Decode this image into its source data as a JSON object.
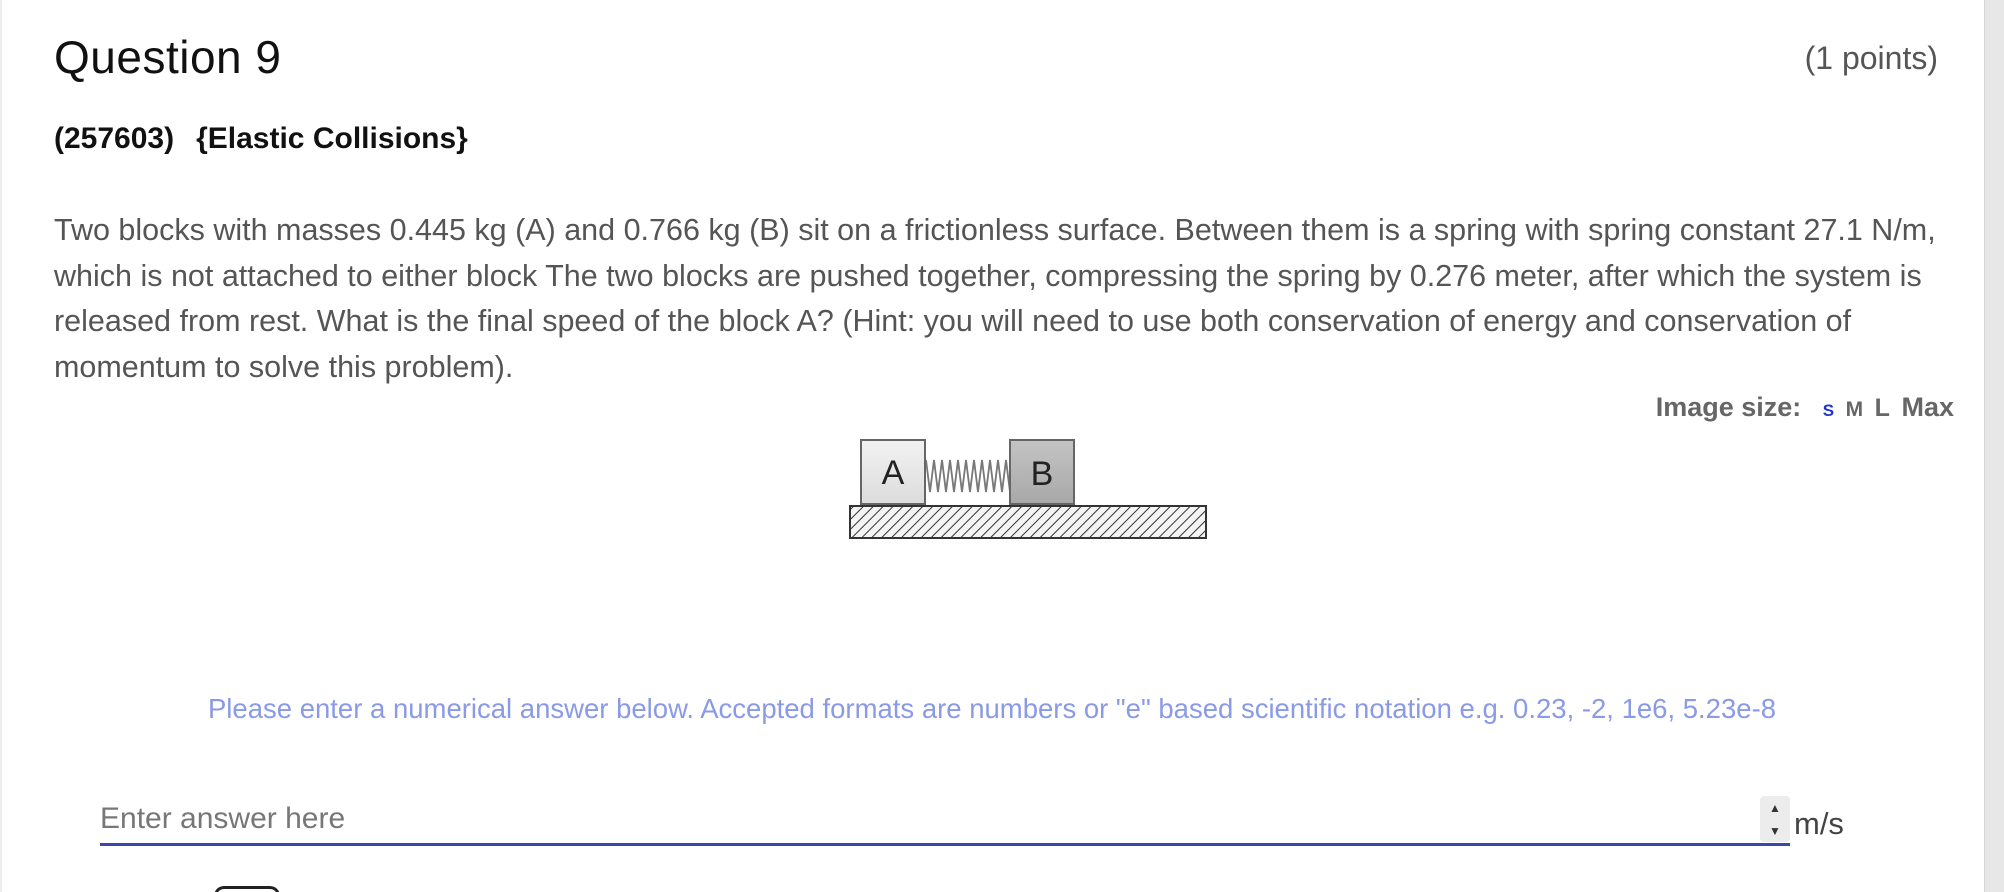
{
  "question": {
    "title": "Question 9",
    "points": "(1 points)",
    "id": "(257603)",
    "topic": "{Elastic Collisions}",
    "body": "Two blocks with masses 0.445 kg (A) and 0.766 kg (B) sit on a frictionless surface. Between them is a spring with spring constant 27.1 N/m, which is not attached to either block The two blocks are pushed together, compressing the spring by 0.276 meter, after which the system is released from rest.  What is the final speed of the block A? (Hint: you will need to use both conservation of energy and conservation of momentum to solve this problem)."
  },
  "image_size": {
    "label": "Image size:",
    "options": [
      "S",
      "M",
      "L",
      "Max"
    ],
    "selected": "S"
  },
  "figure": {
    "block_a_label": "A",
    "block_b_label": "B"
  },
  "answer": {
    "hint": "Please enter a numerical answer below. Accepted formats are numbers or \"e\" based scientific notation e.g. 0.23, -2, 1e6, 5.23e-8",
    "placeholder": "Enter answer here",
    "value": "",
    "unit": "m/s"
  },
  "colors": {
    "hint": "#8a9ae6",
    "underline": "#3949ab",
    "selected_size": "#2233cc"
  }
}
